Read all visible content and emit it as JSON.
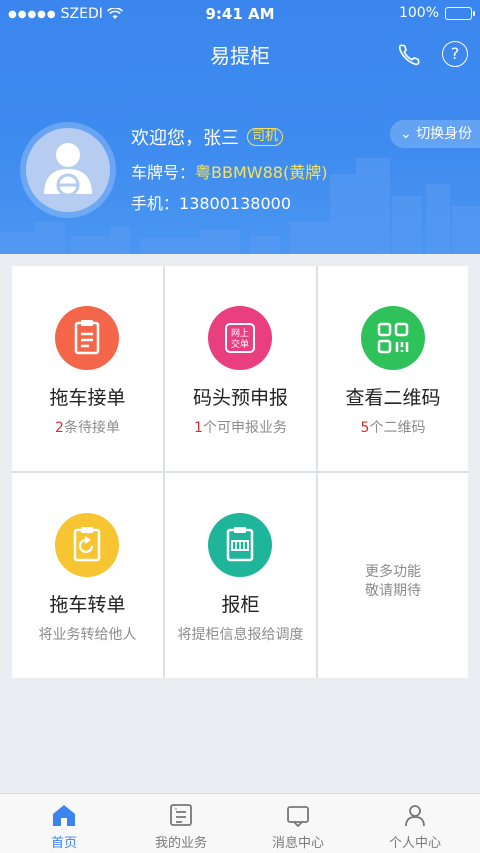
{
  "status_bar": {
    "carrier": "SZEDI",
    "time": "9:41 AM",
    "battery": "100%"
  },
  "nav": {
    "title": "易提柜"
  },
  "profile": {
    "welcome": "欢迎您，张三",
    "role_badge": "司机",
    "switch_role": "切换身份",
    "plate_label": "车牌号：",
    "plate_value": "粤BBMW88(黄牌)",
    "phone_label": "手机：",
    "phone_value": "13800138000"
  },
  "services": [
    {
      "title": "拖车接单",
      "count": "2",
      "sub": "条待接单",
      "icon": "order-clipboard-icon",
      "color": "#f4664a"
    },
    {
      "title": "码头预申报",
      "count": "1",
      "sub": "个可申报业务",
      "icon": "online-order-icon",
      "color": "#ea3f7f"
    },
    {
      "title": "查看二维码",
      "count": "5",
      "sub": "个二维码",
      "icon": "qrcode-icon",
      "color": "#2fc25b"
    },
    {
      "title": "拖车转单",
      "count": "",
      "sub": "将业务转给他人",
      "icon": "transfer-order-icon",
      "color": "#f7c531"
    },
    {
      "title": "报柜",
      "count": "",
      "sub": "将提柜信息报给调度",
      "icon": "container-report-icon",
      "color": "#1fb59a"
    }
  ],
  "more": {
    "line1": "更多功能",
    "line2": "敬请期待"
  },
  "tabs": [
    {
      "label": "首页",
      "icon": "home-icon",
      "active": true
    },
    {
      "label": "我的业务",
      "icon": "business-icon",
      "active": false
    },
    {
      "label": "消息中心",
      "icon": "message-icon",
      "active": false
    },
    {
      "label": "个人中心",
      "icon": "profile-icon",
      "active": false
    }
  ],
  "colors": {
    "primary": "#3a86ee",
    "accent_yellow": "#f7e35a",
    "count_red": "#d2302f"
  }
}
